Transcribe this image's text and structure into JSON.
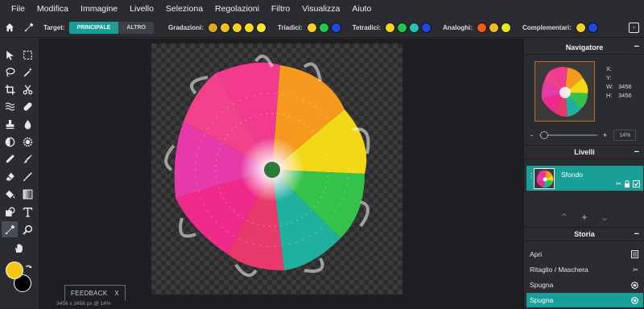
{
  "menu": [
    "File",
    "Modifica",
    "Immagine",
    "Livello",
    "Seleziona",
    "Regolazioni",
    "Filtro",
    "Visualizza",
    "Aiuto"
  ],
  "options": {
    "target_label": "Target:",
    "target_primary": "PRINCIPALE",
    "target_secondary": "ALTRO",
    "gradations_label": "Gradazioni:",
    "gradations_colors": [
      "#e0a81a",
      "#f0c020",
      "#f5d21e",
      "#f8de22",
      "#fbe72a"
    ],
    "triadic_label": "Triadici:",
    "triadic_colors": [
      "#f5d21e",
      "#21c64a",
      "#2146e0"
    ],
    "tetradic_label": "Tetradici:",
    "tetradic_colors": [
      "#f5d21e",
      "#21c64a",
      "#21c6b0",
      "#2146e0"
    ],
    "analogous_label": "Analoghi:",
    "analogous_colors": [
      "#f05a1a",
      "#f5b81e",
      "#e6e81e"
    ],
    "complementary_label": "Complementari:",
    "complementary_colors": [
      "#f5d21e",
      "#2146e0"
    ]
  },
  "toolbar": {
    "tools": [
      "move",
      "marquee",
      "lasso",
      "magic-wand",
      "crop",
      "slice",
      "liquify",
      "heal",
      "clone-stamp",
      "blur",
      "dodge",
      "sponge",
      "pencil",
      "brush",
      "eraser",
      "color-replace",
      "paint-bucket",
      "gradient",
      "shape",
      "text",
      "color-picker",
      "zoom",
      "hand"
    ],
    "active_tool": "color-picker",
    "foreground_color": "#f5c518",
    "background_color": "#000000"
  },
  "canvas": {
    "feedback_label": "FEEDBACK",
    "feedback_close": "X",
    "status": "3456 x 3456 px @ 14%"
  },
  "navigator": {
    "title": "Navigatore",
    "x_label": "X:",
    "y_label": "Y:",
    "w_label": "W:",
    "w_value": "3456",
    "h_label": "H:",
    "h_value": "3456",
    "zoom_minus": "-",
    "zoom_plus": "+",
    "zoom_value": "14%"
  },
  "layers": {
    "title": "Livelli",
    "items": [
      {
        "name": "Sfondo"
      }
    ]
  },
  "history": {
    "title": "Storia",
    "items": [
      {
        "label": "Apri",
        "icon": "document-icon"
      },
      {
        "label": "Ritaglio / Maschera",
        "icon": "scissors-icon"
      },
      {
        "label": "Spugna",
        "icon": "sponge-icon"
      },
      {
        "label": "Spugna",
        "icon": "sponge-icon"
      }
    ],
    "selected_index": 3
  }
}
